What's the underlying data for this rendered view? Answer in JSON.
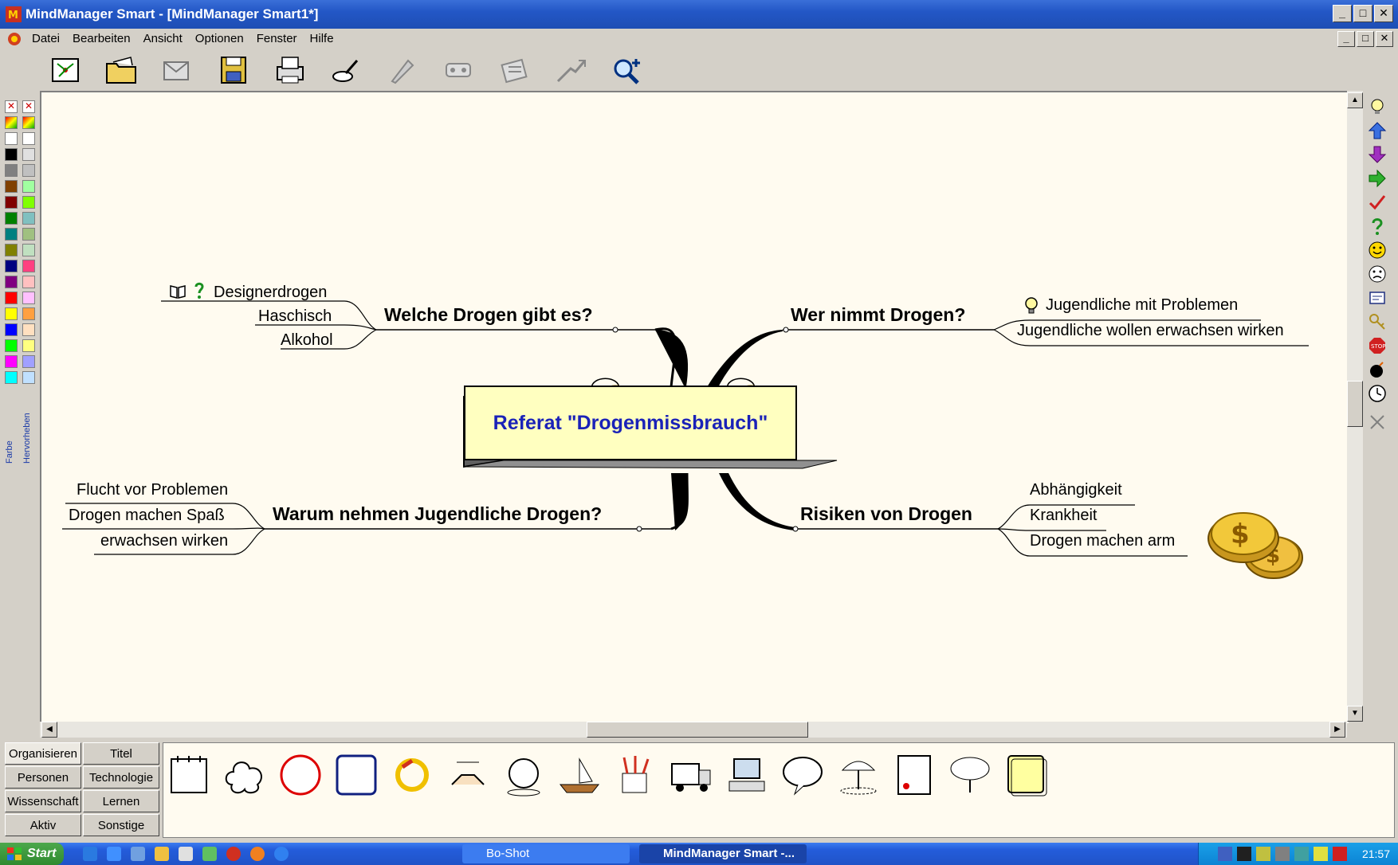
{
  "window": {
    "title": "MindManager Smart - [MindManager Smart1*]",
    "controls": [
      "_",
      "□",
      "✕"
    ]
  },
  "menu": {
    "items": [
      "Datei",
      "Bearbeiten",
      "Ansicht",
      "Optionen",
      "Fenster",
      "Hilfe"
    ]
  },
  "toolbar": {
    "icons": [
      "new-map-icon",
      "open-icon",
      "send-icon",
      "save-icon",
      "print-icon",
      "highlighter-icon",
      "rocket-icon",
      "presentation-icon",
      "brainstorm-icon",
      "export-icon",
      "zoom-in-icon"
    ]
  },
  "palette": {
    "farbe_label": "Farbe",
    "hervorheben_label": "Hervorheben",
    "farbe_colors": [
      "#ffffff",
      "#000000",
      "#808080",
      "#804000",
      "#800000",
      "#008000",
      "#008080",
      "#808000",
      "#000080",
      "#800080",
      "#ff0000",
      "#ffff00",
      "#0000ff",
      "#00ff00",
      "#ff00ff",
      "#00ffff"
    ],
    "hervorheben_colors": [
      "#ffffff",
      "#e0e0e0",
      "#c0c0c0",
      "#a0ffa0",
      "#80ff00",
      "#80c0c0",
      "#a0c080",
      "#c0e0c0",
      "#ff4080",
      "#ffc0c0",
      "#ffc0ff",
      "#ffa040",
      "#ffe0c0",
      "#ffff80",
      "#a0a0ff",
      "#c0e0ff"
    ]
  },
  "mindmap": {
    "central": "Referat \"Drogenmissbrauch\"",
    "branches": [
      {
        "title": "Welche Drogen gibt es?",
        "children": [
          "Designerdrogen",
          "Haschisch",
          "Alkohol"
        ]
      },
      {
        "title": "Wer nimmt Drogen?",
        "children": [
          "Jugendliche mit Problemen",
          "Jugendliche wollen erwachsen wirken"
        ]
      },
      {
        "title": "Warum nehmen Jugendliche Drogen?",
        "children": [
          "Flucht vor Problemen",
          "Drogen machen Spaß",
          "erwachsen wirken"
        ]
      },
      {
        "title": "Risiken von Drogen",
        "children": [
          "Abhängigkeit",
          "Krankheit",
          "Drogen machen arm"
        ]
      }
    ],
    "node_icons": [
      "book-icon",
      "question-icon",
      "lightbulb-icon",
      "coins-icon"
    ]
  },
  "right_icons": [
    "lightbulb-icon",
    "arrow-up-icon",
    "arrow-down-icon",
    "arrow-right-icon",
    "checkmark-icon",
    "question-icon",
    "smiley-happy-icon",
    "smiley-sad-icon",
    "card-icon",
    "key-icon",
    "stop-icon",
    "bomb-icon",
    "clock-icon",
    "close-icon"
  ],
  "library": {
    "tabs": [
      "Organisieren",
      "Titel",
      "Personen",
      "Technologie",
      "Wissenschaft",
      "Lernen",
      "Aktiv",
      "Sonstige"
    ],
    "active_tab": "Organisieren",
    "items": [
      "notepad-icon",
      "cloud-icon",
      "red-circle-icon",
      "blue-frame-icon",
      "circle-arrows-icon",
      "handshake-icon",
      "globe-icon",
      "ship-icon",
      "pencils-icon",
      "truck-icon",
      "computer-icon",
      "speech-bubble-icon",
      "umbrella-icon",
      "document-icon",
      "cloud-umbrella-icon",
      "yellow-note-icon"
    ]
  },
  "taskbar": {
    "start": "Start",
    "tasks": [
      "Bo-Shot",
      "MindManager Smart -..."
    ],
    "clock": "21:57"
  },
  "colors": {
    "titlebar": "#2357c6",
    "canvas": "#fffbf0",
    "central_fill": "#ffffc0",
    "central_text": "#1a22b8"
  }
}
